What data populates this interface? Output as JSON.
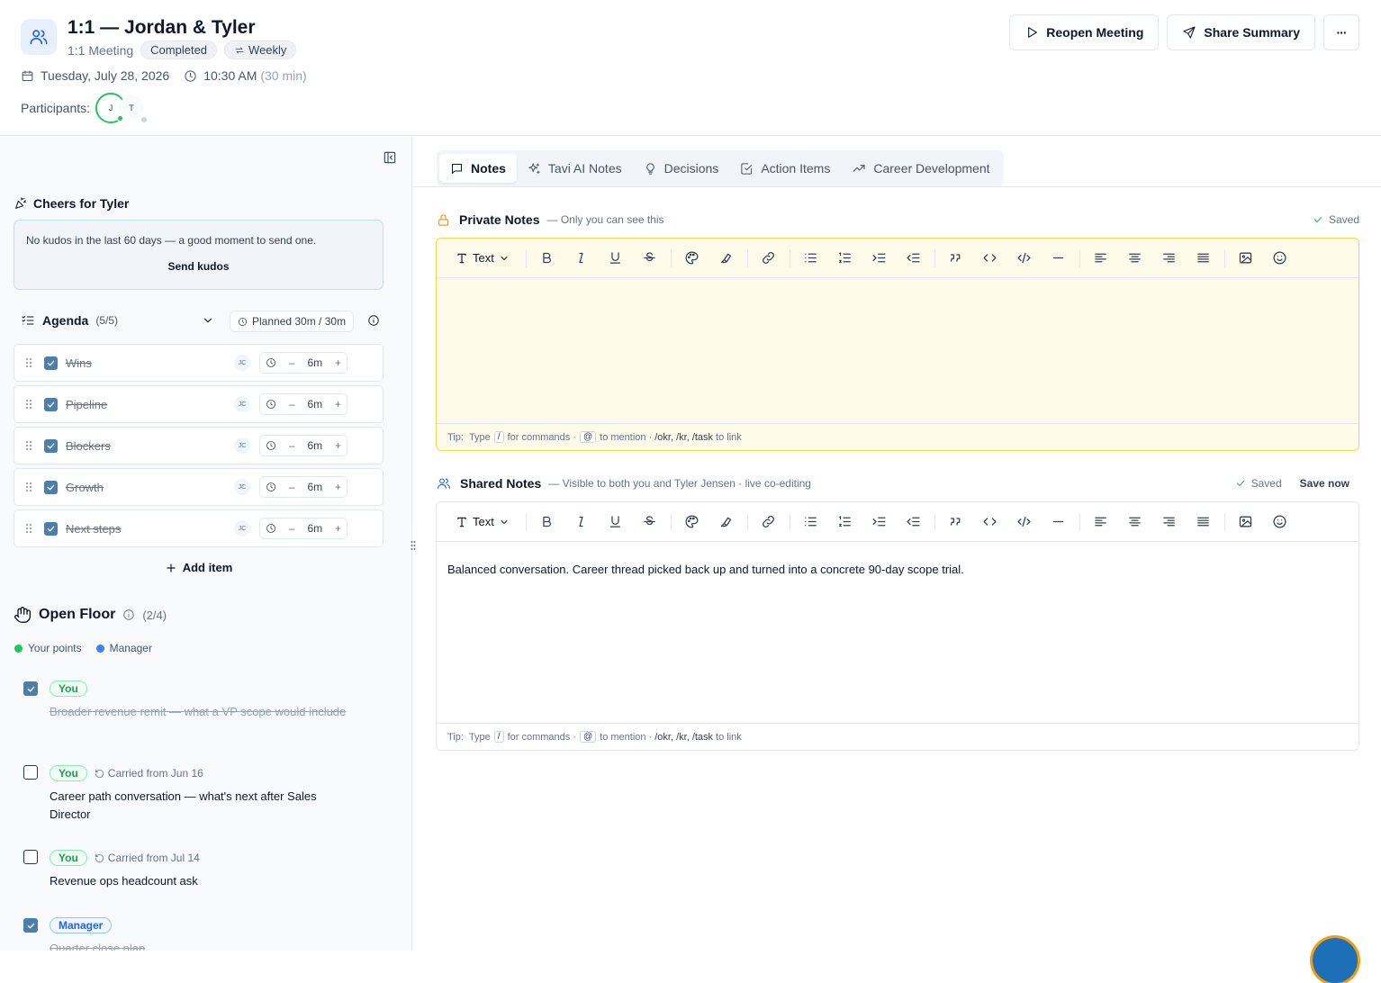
{
  "header": {
    "title": "1:1 — Jordan & Tyler",
    "meeting_type": "1:1 Meeting",
    "status": "Completed",
    "recurrence": "Weekly",
    "date": "Tuesday, July 28, 2026",
    "time": "10:30 AM",
    "duration": "(30 min)",
    "participants_label": "Participants:",
    "participants": [
      "J",
      "T"
    ],
    "reopen_label": "Reopen Meeting",
    "share_label": "Share Summary",
    "more_label": "···"
  },
  "sidebar": {
    "cheers_title": "Cheers for Tyler",
    "kudos_text": "No kudos in the last 60 days — a good moment to send one.",
    "kudos_button": "Send kudos",
    "agenda_title": "Agenda",
    "agenda_count": "(5/5)",
    "planned": "Planned 30m / 30m",
    "agenda_items": [
      {
        "title": "Wins",
        "owner": "JC",
        "duration": "6m"
      },
      {
        "title": "Pipeline",
        "owner": "JC",
        "duration": "6m"
      },
      {
        "title": "Blockers",
        "owner": "JC",
        "duration": "6m"
      },
      {
        "title": "Growth",
        "owner": "JC",
        "duration": "6m"
      },
      {
        "title": "Next steps",
        "owner": "JC",
        "duration": "6m"
      }
    ],
    "add_item": "Add item",
    "open_floor_title": "Open Floor",
    "open_floor_count": "(2/4)",
    "legend_yours": "Your points",
    "legend_manager": "Manager",
    "open_floor_items": [
      {
        "tag": "You",
        "carried": "",
        "text": "Broader revenue remit — what a VP scope would include",
        "done": true
      },
      {
        "tag": "You",
        "carried": "Carried from Jun 16",
        "text": "Career path conversation — what's next after Sales Director",
        "done": false
      },
      {
        "tag": "You",
        "carried": "Carried from Jul 14",
        "text": "Revenue ops headcount ask",
        "done": false
      },
      {
        "tag": "Manager",
        "carried": "",
        "text": "Quarter close plan",
        "done": true
      }
    ]
  },
  "tabs": [
    "Notes",
    "Tavi AI Notes",
    "Decisions",
    "Action Items",
    "Career Development"
  ],
  "private_notes": {
    "title": "Private Notes",
    "subtitle": "— Only you can see this",
    "saved": "Saved",
    "toolbar_text": "Text",
    "content": ""
  },
  "shared_notes": {
    "title": "Shared Notes",
    "subtitle": "— Visible to both you and Tyler Jensen · live co-editing",
    "saved": "Saved",
    "save_now": "Save now",
    "toolbar_text": "Text",
    "content": "Balanced conversation. Career thread picked back up and turned into a concrete 90-day scope trial."
  },
  "tip": {
    "tip_label": "Tip:",
    "type_label": "Type",
    "slash": "/",
    "commands": "for commands ·",
    "at": "@",
    "mention": "to mention ·",
    "links": "/okr, /kr, /task",
    "link_suffix": "to link"
  },
  "colors": {
    "accent_blue": "#2563eb",
    "you_green": "#16a34a",
    "manager_blue": "#2563eb",
    "private_bg": "#fffbeb",
    "private_border": "#fcd34d"
  }
}
